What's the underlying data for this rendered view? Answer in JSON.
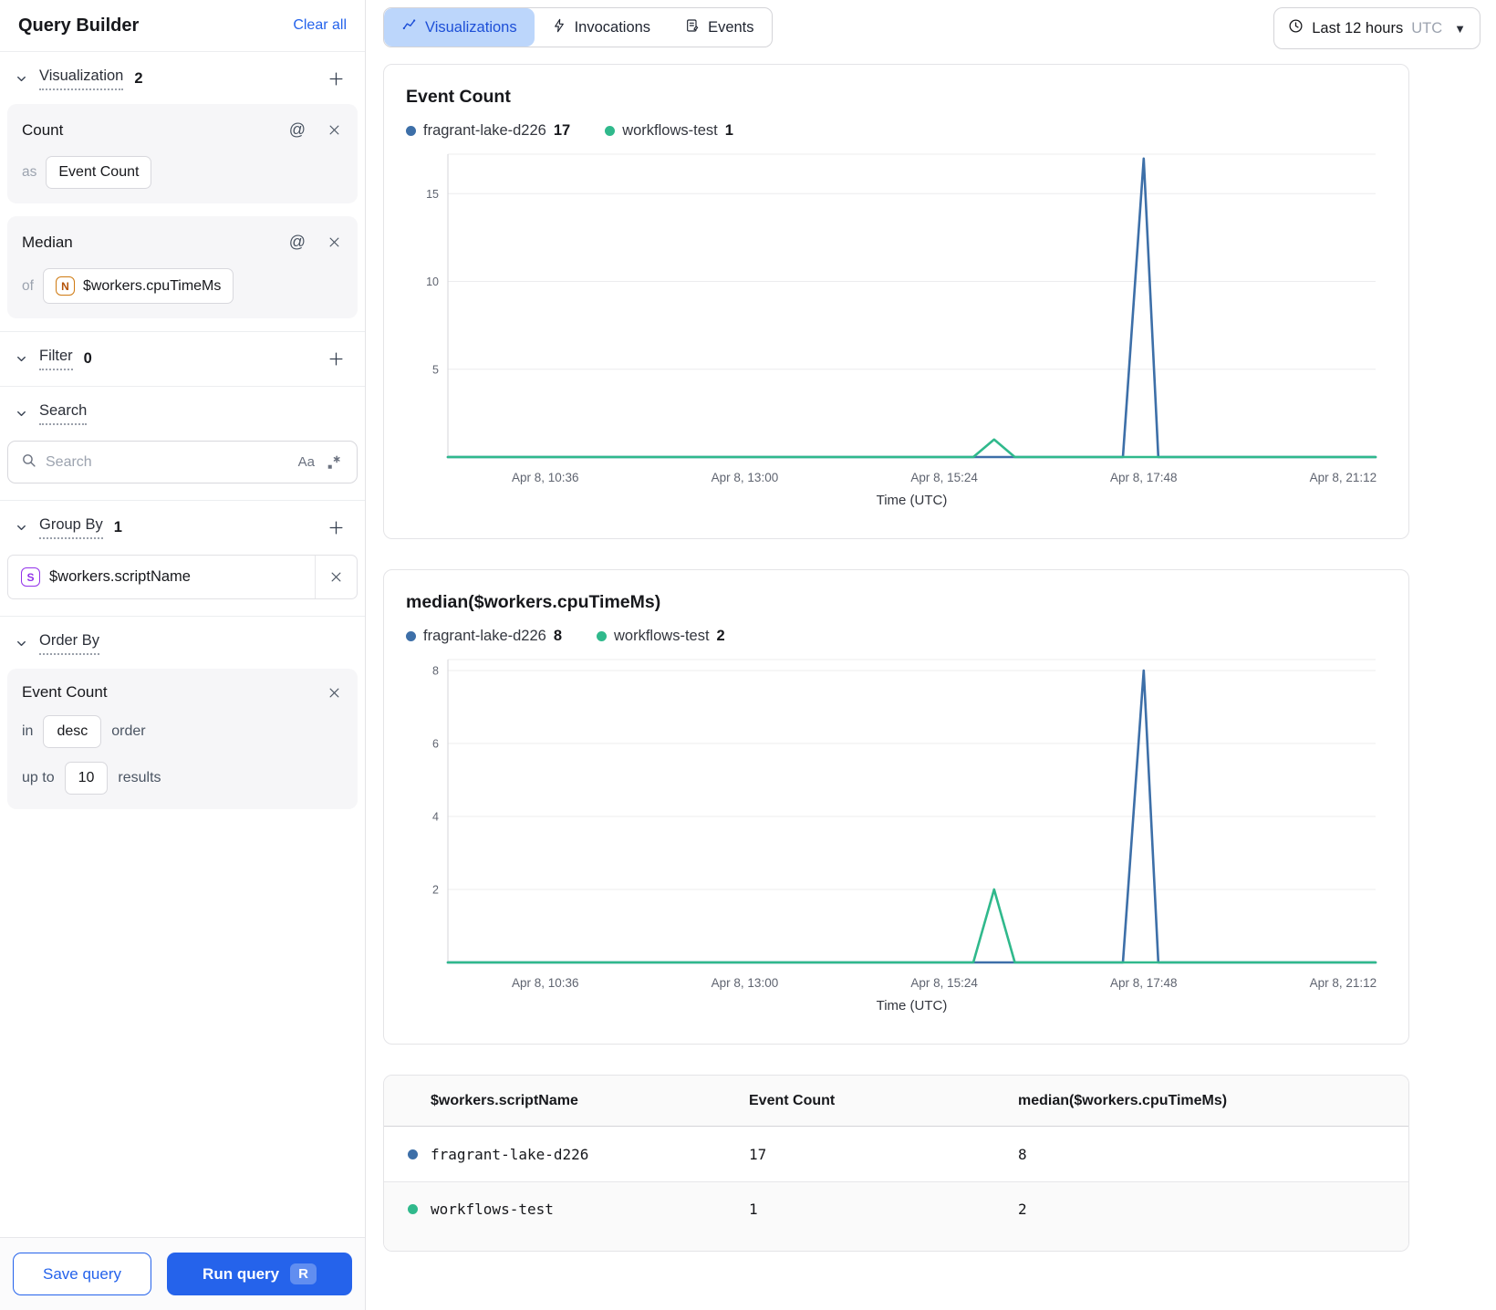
{
  "icons": {
    "at": "@"
  },
  "sidebar": {
    "title": "Query Builder",
    "clear_all": "Clear all",
    "visualization": {
      "label": "Visualization",
      "count": "2",
      "cards": [
        {
          "title": "Count",
          "prefix": "as",
          "value": "Event Count"
        },
        {
          "title": "Median",
          "prefix": "of",
          "value": "$workers.cpuTimeMs",
          "icon": "N"
        }
      ]
    },
    "filter": {
      "label": "Filter",
      "count": "0"
    },
    "search": {
      "label": "Search",
      "placeholder": "Search",
      "case_toggle": "Aa"
    },
    "group_by": {
      "label": "Group By",
      "count": "1",
      "item": {
        "icon": "S",
        "value": "$workers.scriptName"
      }
    },
    "order_by": {
      "label": "Order By",
      "card": {
        "field": "Event Count",
        "in_word": "in",
        "direction": "desc",
        "order_word": "order",
        "upto_word": "up to",
        "limit": "10",
        "results_word": "results"
      }
    },
    "footer": {
      "save": "Save query",
      "run": "Run query",
      "shortcut": "R"
    }
  },
  "header": {
    "tabs": [
      {
        "label": "Visualizations",
        "active": true
      },
      {
        "label": "Invocations",
        "active": false
      },
      {
        "label": "Events",
        "active": false
      }
    ],
    "time_range": {
      "label": "Last 12 hours",
      "timezone": "UTC"
    }
  },
  "chart_data": [
    {
      "type": "line",
      "title": "Event Count",
      "xlabel": "Time (UTC)",
      "ylim": [
        0,
        17.25
      ],
      "yticks": [
        5,
        10,
        15
      ],
      "grid": true,
      "legend_position": "top",
      "x_ticks": [
        {
          "minutes": 636,
          "label": "Apr 8, 10:36"
        },
        {
          "minutes": 780,
          "label": "Apr 8, 13:00"
        },
        {
          "minutes": 924,
          "label": "Apr 8, 15:24"
        },
        {
          "minutes": 1068,
          "label": "Apr 8, 17:48"
        },
        {
          "minutes": 1272,
          "label": "Apr 8, 21:12"
        }
      ],
      "legend": [
        {
          "name": "fragrant-lake-d226",
          "total": "17"
        },
        {
          "name": "workflows-test",
          "total": "1"
        }
      ],
      "series": [
        {
          "name": "fragrant-lake-d226",
          "color": "#3d6fa8",
          "points": [
            [
              558,
              0
            ],
            [
              1053,
              0
            ],
            [
              1068,
              17
            ],
            [
              1083,
              0
            ],
            [
              1310,
              0
            ]
          ]
        },
        {
          "name": "workflows-test",
          "color": "#30b98c",
          "points": [
            [
              558,
              0
            ],
            [
              945,
              0
            ],
            [
              960,
              1
            ],
            [
              975,
              0
            ],
            [
              1310,
              0
            ]
          ]
        }
      ]
    },
    {
      "type": "line",
      "title": "median($workers.cpuTimeMs)",
      "xlabel": "Time (UTC)",
      "ylim": [
        0,
        8.3
      ],
      "yticks": [
        2,
        4,
        6,
        8
      ],
      "grid": true,
      "legend_position": "top",
      "x_ticks": [
        {
          "minutes": 636,
          "label": "Apr 8, 10:36"
        },
        {
          "minutes": 780,
          "label": "Apr 8, 13:00"
        },
        {
          "minutes": 924,
          "label": "Apr 8, 15:24"
        },
        {
          "minutes": 1068,
          "label": "Apr 8, 17:48"
        },
        {
          "minutes": 1272,
          "label": "Apr 8, 21:12"
        }
      ],
      "legend": [
        {
          "name": "fragrant-lake-d226",
          "total": "8"
        },
        {
          "name": "workflows-test",
          "total": "2"
        }
      ],
      "series": [
        {
          "name": "fragrant-lake-d226",
          "color": "#3d6fa8",
          "points": [
            [
              558,
              0
            ],
            [
              1053,
              0
            ],
            [
              1068,
              8
            ],
            [
              1083,
              0
            ],
            [
              1310,
              0
            ]
          ]
        },
        {
          "name": "workflows-test",
          "color": "#30b98c",
          "points": [
            [
              558,
              0
            ],
            [
              945,
              0
            ],
            [
              960,
              2
            ],
            [
              975,
              0
            ],
            [
              1310,
              0
            ]
          ]
        }
      ]
    }
  ],
  "table": {
    "headers": [
      "$workers.scriptName",
      "Event Count",
      "median($workers.cpuTimeMs)"
    ],
    "rows": [
      {
        "color": "#3d6fa8",
        "name": "fragrant-lake-d226",
        "event_count": "17",
        "median": "8"
      },
      {
        "color": "#30b98c",
        "name": "workflows-test",
        "event_count": "1",
        "median": "2"
      }
    ]
  },
  "colors": {
    "accent": "#2563eb",
    "tab_selected_bg": "#bcd6fb",
    "series_blue": "#3d6fa8",
    "series_green": "#30b98c"
  }
}
